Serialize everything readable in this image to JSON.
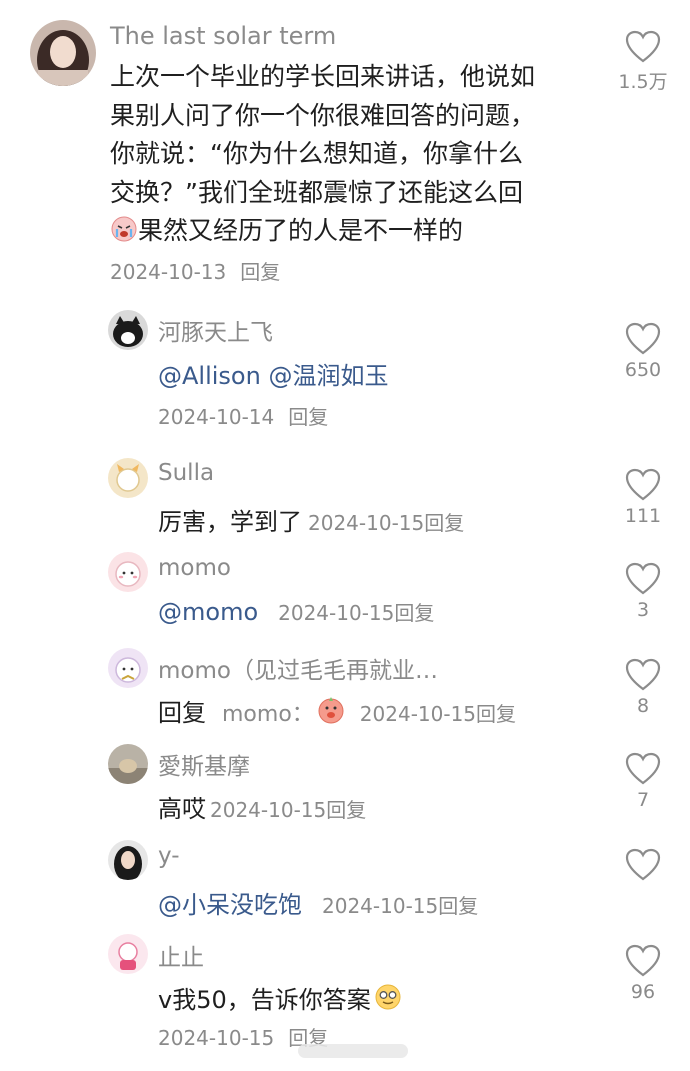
{
  "main_comment": {
    "username": "The last solar term",
    "text_lines": [
      "上次一个毕业的学长回来讲话，他说如",
      "果别人问了你一个你很难回答的问题，",
      "你就说：“你为什么想知道，你拿什么",
      "交换？”我们全班都震惊了还能这么回",
      "果然又经历了的人是不一样的"
    ],
    "date": "2024-10-13",
    "reply_label": "回复",
    "likes": "1.5万"
  },
  "replies": [
    {
      "username": "河豚天上飞",
      "text": "@Allison  @温润如玉",
      "date": "2024-10-14",
      "reply_label": "回复",
      "likes": "650"
    },
    {
      "username": "Sulla",
      "text": "厉害，学到了",
      "date": "2024-10-15",
      "reply_label": "回复",
      "likes": "111"
    },
    {
      "username": "momo",
      "text": "@momo",
      "date": "2024-10-15",
      "reply_label": "回复",
      "likes": "3"
    },
    {
      "username": "momo（见过毛毛再就业…",
      "text": "回复",
      "reply_target": "momo：",
      "date": "2024-10-15",
      "reply_label": "回复",
      "likes": "8"
    },
    {
      "username": "愛斯基摩",
      "text": "高哎",
      "date": "2024-10-15",
      "reply_label": "回复",
      "likes": "7"
    },
    {
      "username": "y-",
      "text": "@小呆没吃饱",
      "date": "2024-10-15",
      "reply_label": "回复",
      "likes": ""
    },
    {
      "username": "止止",
      "text": "v我50，告诉你答案",
      "date": "2024-10-15",
      "reply_label": "回复",
      "likes": "96"
    }
  ],
  "icons": {
    "like": "heart-outline-icon",
    "emoji_crying": "crying-face-emoji",
    "emoji_pig": "pig-face-emoji",
    "emoji_glasses": "glasses-face-emoji"
  }
}
